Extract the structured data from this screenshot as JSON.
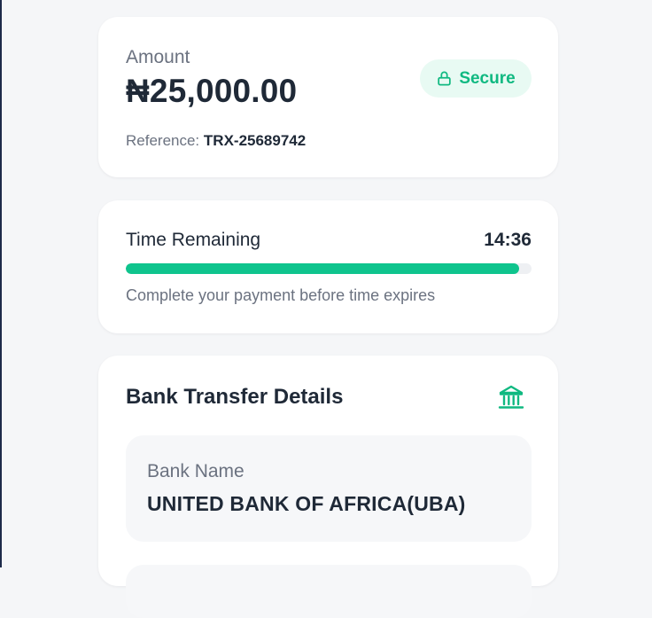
{
  "payment": {
    "amount_label": "Amount",
    "amount_value": "₦25,000.00",
    "reference_label": "Reference:",
    "reference_value": "TRX-25689742",
    "secure_label": "Secure"
  },
  "timer": {
    "title": "Time Remaining",
    "value": "14:36",
    "progress_fraction": 0.97,
    "hint": "Complete your payment before time expires"
  },
  "bank": {
    "title": "Bank Transfer Details",
    "icon": "bank-icon",
    "fields": [
      {
        "label": "Bank Name",
        "value": "UNITED BANK OF AFRICA(UBA)"
      }
    ]
  },
  "colors": {
    "accent": "#10b981",
    "progress": "#0fc48d",
    "badge_bg": "#e8faf3",
    "text_primary": "#1f2937",
    "text_secondary": "#6b7280",
    "page_bg": "#f5f6f8",
    "card_bg": "#ffffff"
  }
}
